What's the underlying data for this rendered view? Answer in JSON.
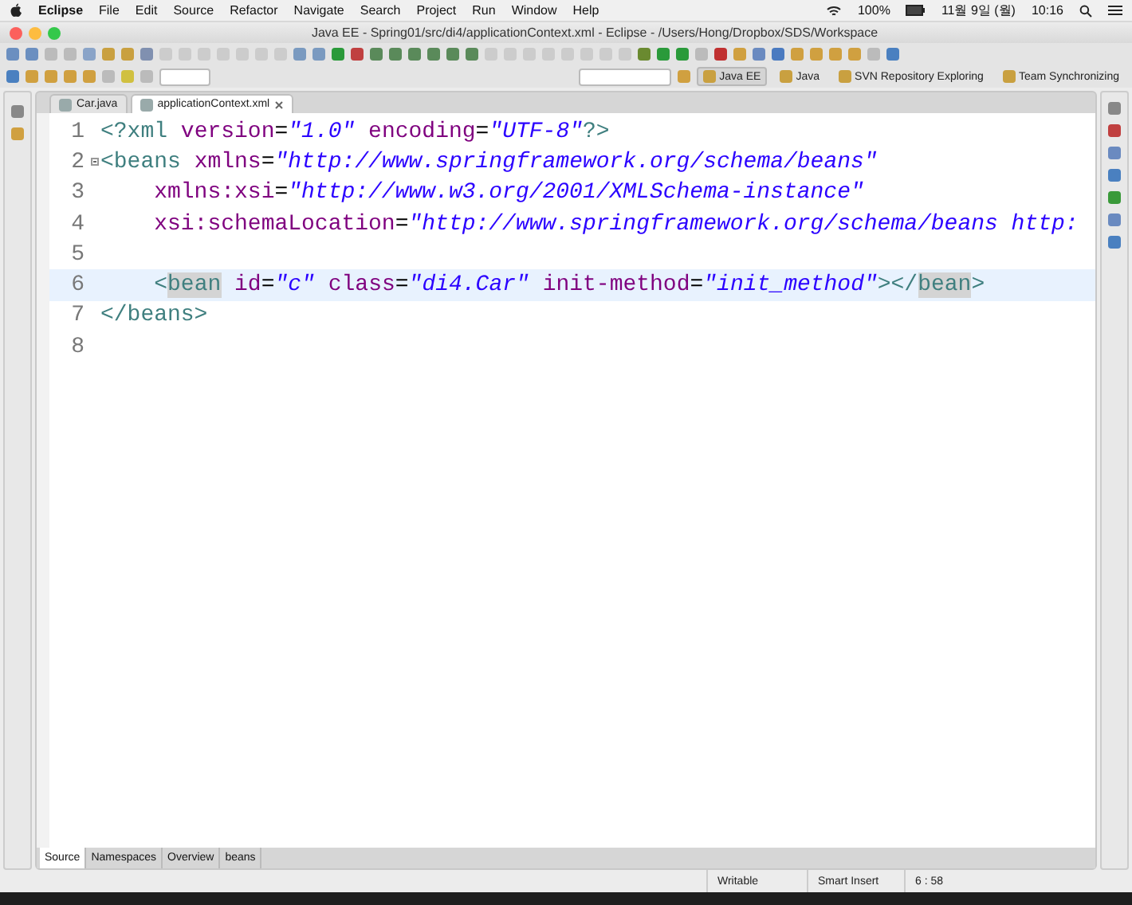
{
  "menu_bar": {
    "items": [
      "Eclipse",
      "File",
      "Edit",
      "Source",
      "Refactor",
      "Navigate",
      "Search",
      "Project",
      "Run",
      "Window",
      "Help"
    ],
    "status": {
      "battery": "100%",
      "date": "11월 9일 (월)",
      "time": "10:16"
    }
  },
  "window": {
    "title": "Java EE - Spring01/src/di4/applicationContext.xml - Eclipse - /Users/Hong/Dropbox/SDS/Workspace"
  },
  "perspectives": [
    {
      "label": "Java EE",
      "selected": true
    },
    {
      "label": "Java",
      "selected": false
    },
    {
      "label": "SVN Repository Exploring",
      "selected": false
    },
    {
      "label": "Team Synchronizing",
      "selected": false
    }
  ],
  "editor_tabs": [
    {
      "label": "Car.java",
      "selected": false
    },
    {
      "label": "applicationContext.xml",
      "selected": true
    }
  ],
  "editor": {
    "lines": [
      {
        "number": "1",
        "current": false,
        "tokens": [
          {
            "kind": "tag",
            "text": "<?xml"
          },
          {
            "kind": "attr",
            "text": " version"
          },
          {
            "kind": "plain",
            "text": "="
          },
          {
            "kind": "value",
            "text": "\"1.0\""
          },
          {
            "kind": "attr",
            "text": " encoding"
          },
          {
            "kind": "plain",
            "text": "="
          },
          {
            "kind": "value",
            "text": "\"UTF-8\""
          },
          {
            "kind": "tag",
            "text": "?>"
          }
        ]
      },
      {
        "number": "2",
        "current": false,
        "fold": true,
        "tokens": [
          {
            "kind": "tag",
            "text": "<beans"
          },
          {
            "kind": "attr",
            "text": " xmlns"
          },
          {
            "kind": "plain",
            "text": "="
          },
          {
            "kind": "value",
            "text": "\"http://www.springframework.org/schema/beans\""
          }
        ]
      },
      {
        "number": "3",
        "current": false,
        "tokens": [
          {
            "kind": "attr",
            "text": "    xmlns:xsi"
          },
          {
            "kind": "plain",
            "text": "="
          },
          {
            "kind": "value",
            "text": "\"http://www.w3.org/2001/XMLSchema-instance\""
          }
        ]
      },
      {
        "number": "4",
        "current": false,
        "tokens": [
          {
            "kind": "attr",
            "text": "    xsi:schemaLocation"
          },
          {
            "kind": "plain",
            "text": "="
          },
          {
            "kind": "value",
            "text": "\"http://www.springframework.org/schema/beans http:"
          }
        ]
      },
      {
        "number": "5",
        "current": false
      },
      {
        "number": "6",
        "current": true,
        "tokens": [
          {
            "kind": "tag",
            "text": "    <"
          },
          {
            "kind": "marked",
            "text": "bean"
          },
          {
            "kind": "attr",
            "text": " id"
          },
          {
            "kind": "plain",
            "text": "="
          },
          {
            "kind": "value",
            "text": "\"c\""
          },
          {
            "kind": "attr",
            "text": " class"
          },
          {
            "kind": "plain",
            "text": "="
          },
          {
            "kind": "value",
            "text": "\"di4.Car\""
          },
          {
            "kind": "attr",
            "text": " init-method"
          },
          {
            "kind": "plain",
            "text": "="
          },
          {
            "kind": "value",
            "text": "\"init_method\""
          },
          {
            "kind": "tag",
            "text": "></"
          },
          {
            "kind": "marked",
            "text": "bean"
          },
          {
            "kind": "tag",
            "text": ">"
          }
        ]
      },
      {
        "number": "7",
        "current": false,
        "tokens": [
          {
            "kind": "tag",
            "text": "</beans>"
          }
        ]
      },
      {
        "number": "8",
        "current": false
      }
    ]
  },
  "bottom_tabs": [
    {
      "label": "Source",
      "selected": true
    },
    {
      "label": "Namespaces",
      "selected": false
    },
    {
      "label": "Overview",
      "selected": false
    },
    {
      "label": "beans",
      "selected": false
    }
  ],
  "status_bar": {
    "mode": "Writable",
    "insert": "Smart Insert",
    "position": "6 : 58"
  }
}
